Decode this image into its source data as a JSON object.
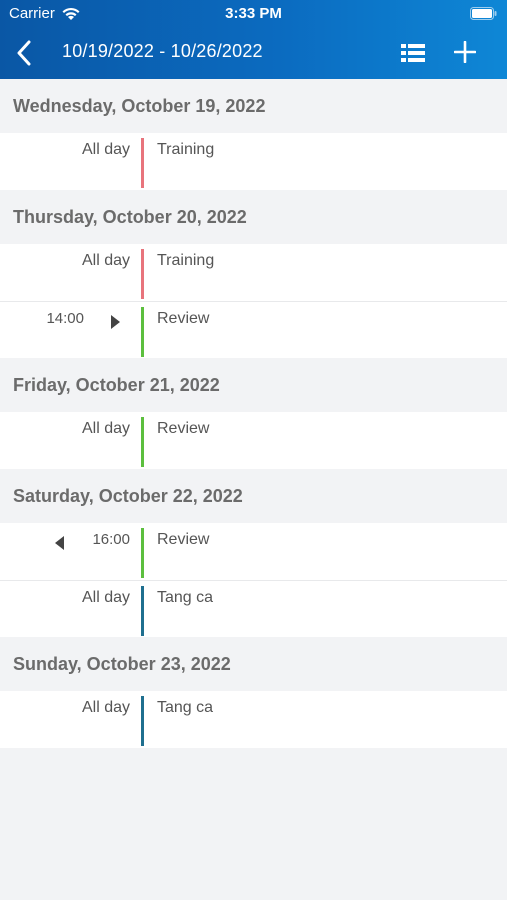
{
  "status_bar": {
    "carrier": "Carrier",
    "time": "3:33 PM"
  },
  "nav": {
    "title": "10/19/2022 - 10/26/2022",
    "back_icon": "chevron-left-icon",
    "list_icon": "list-icon",
    "add_icon": "plus-icon"
  },
  "colors": {
    "training": "#e8747c",
    "review": "#5cbf3e",
    "tang_ca": "#1f6f8f"
  },
  "days": [
    {
      "label": "Wednesday, October 19, 2022",
      "events": [
        {
          "time": "All day",
          "title": "Training",
          "color": "#e8747c"
        }
      ]
    },
    {
      "label": "Thursday, October 20, 2022",
      "events": [
        {
          "time": "All day",
          "title": "Training",
          "color": "#e8747c"
        },
        {
          "time": "14:00",
          "title": "Review",
          "color": "#5cbf3e",
          "arrow": "right"
        }
      ]
    },
    {
      "label": "Friday, October 21, 2022",
      "events": [
        {
          "time": "All day",
          "title": "Review",
          "color": "#5cbf3e"
        }
      ]
    },
    {
      "label": "Saturday, October 22, 2022",
      "events": [
        {
          "time": "16:00",
          "title": "Review",
          "color": "#5cbf3e",
          "arrow": "left"
        },
        {
          "time": "All day",
          "title": "Tang ca",
          "color": "#1f6f8f"
        }
      ]
    },
    {
      "label": "Sunday, October 23, 2022",
      "events": [
        {
          "time": "All day",
          "title": "Tang ca",
          "color": "#1f6f8f"
        }
      ]
    }
  ]
}
